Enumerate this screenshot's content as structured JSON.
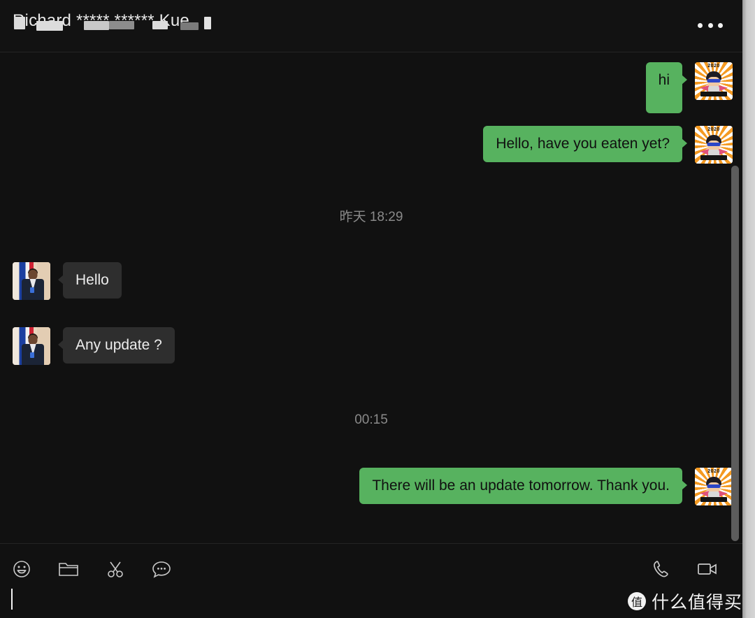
{
  "window": {
    "title_redacted": "Richard ***** ****** Kue",
    "title_visible_tail": "ue",
    "more_menu_label": "•••"
  },
  "colors": {
    "outgoing_bubble": "#57b25f",
    "incoming_bubble": "#2e2e2e",
    "window_background": "#111111",
    "header_background": "#121212",
    "timestamp_text": "#8a8a8a",
    "scrollbar_thumb": "#5c5c5c"
  },
  "conversation": [
    {
      "id": "m1",
      "direction": "out",
      "text": "hi",
      "avatar": "hero-avatar"
    },
    {
      "id": "m2",
      "direction": "out",
      "text": "Hello, have you eaten yet?",
      "avatar": "hero-avatar"
    },
    {
      "id": "t1",
      "direction": "timestamp",
      "text": "昨天 18:29"
    },
    {
      "id": "m3",
      "direction": "in",
      "text": "Hello",
      "avatar": "contact-avatar"
    },
    {
      "id": "m4",
      "direction": "in",
      "text": "Any update ?",
      "avatar": "contact-avatar"
    },
    {
      "id": "t2",
      "direction": "timestamp",
      "text": "00:15"
    },
    {
      "id": "m5",
      "direction": "out",
      "text": "There will be an update tomorrow. Thank you.",
      "avatar": "hero-avatar"
    }
  ],
  "avatar_hero": {
    "year_text": "2020"
  },
  "composer": {
    "input_value": "",
    "input_placeholder": "",
    "tools": [
      {
        "name": "emoji-icon",
        "label": "Emoji"
      },
      {
        "name": "file-icon",
        "label": "Send File"
      },
      {
        "name": "screenshot-icon",
        "label": "Screenshot"
      },
      {
        "name": "chat-history-icon",
        "label": "Chat History"
      }
    ],
    "call_tools": [
      {
        "name": "voice-call-icon",
        "label": "Voice Call"
      },
      {
        "name": "video-call-icon",
        "label": "Video Call"
      }
    ]
  },
  "watermark": {
    "badge": "值",
    "text": "什么值得买"
  }
}
